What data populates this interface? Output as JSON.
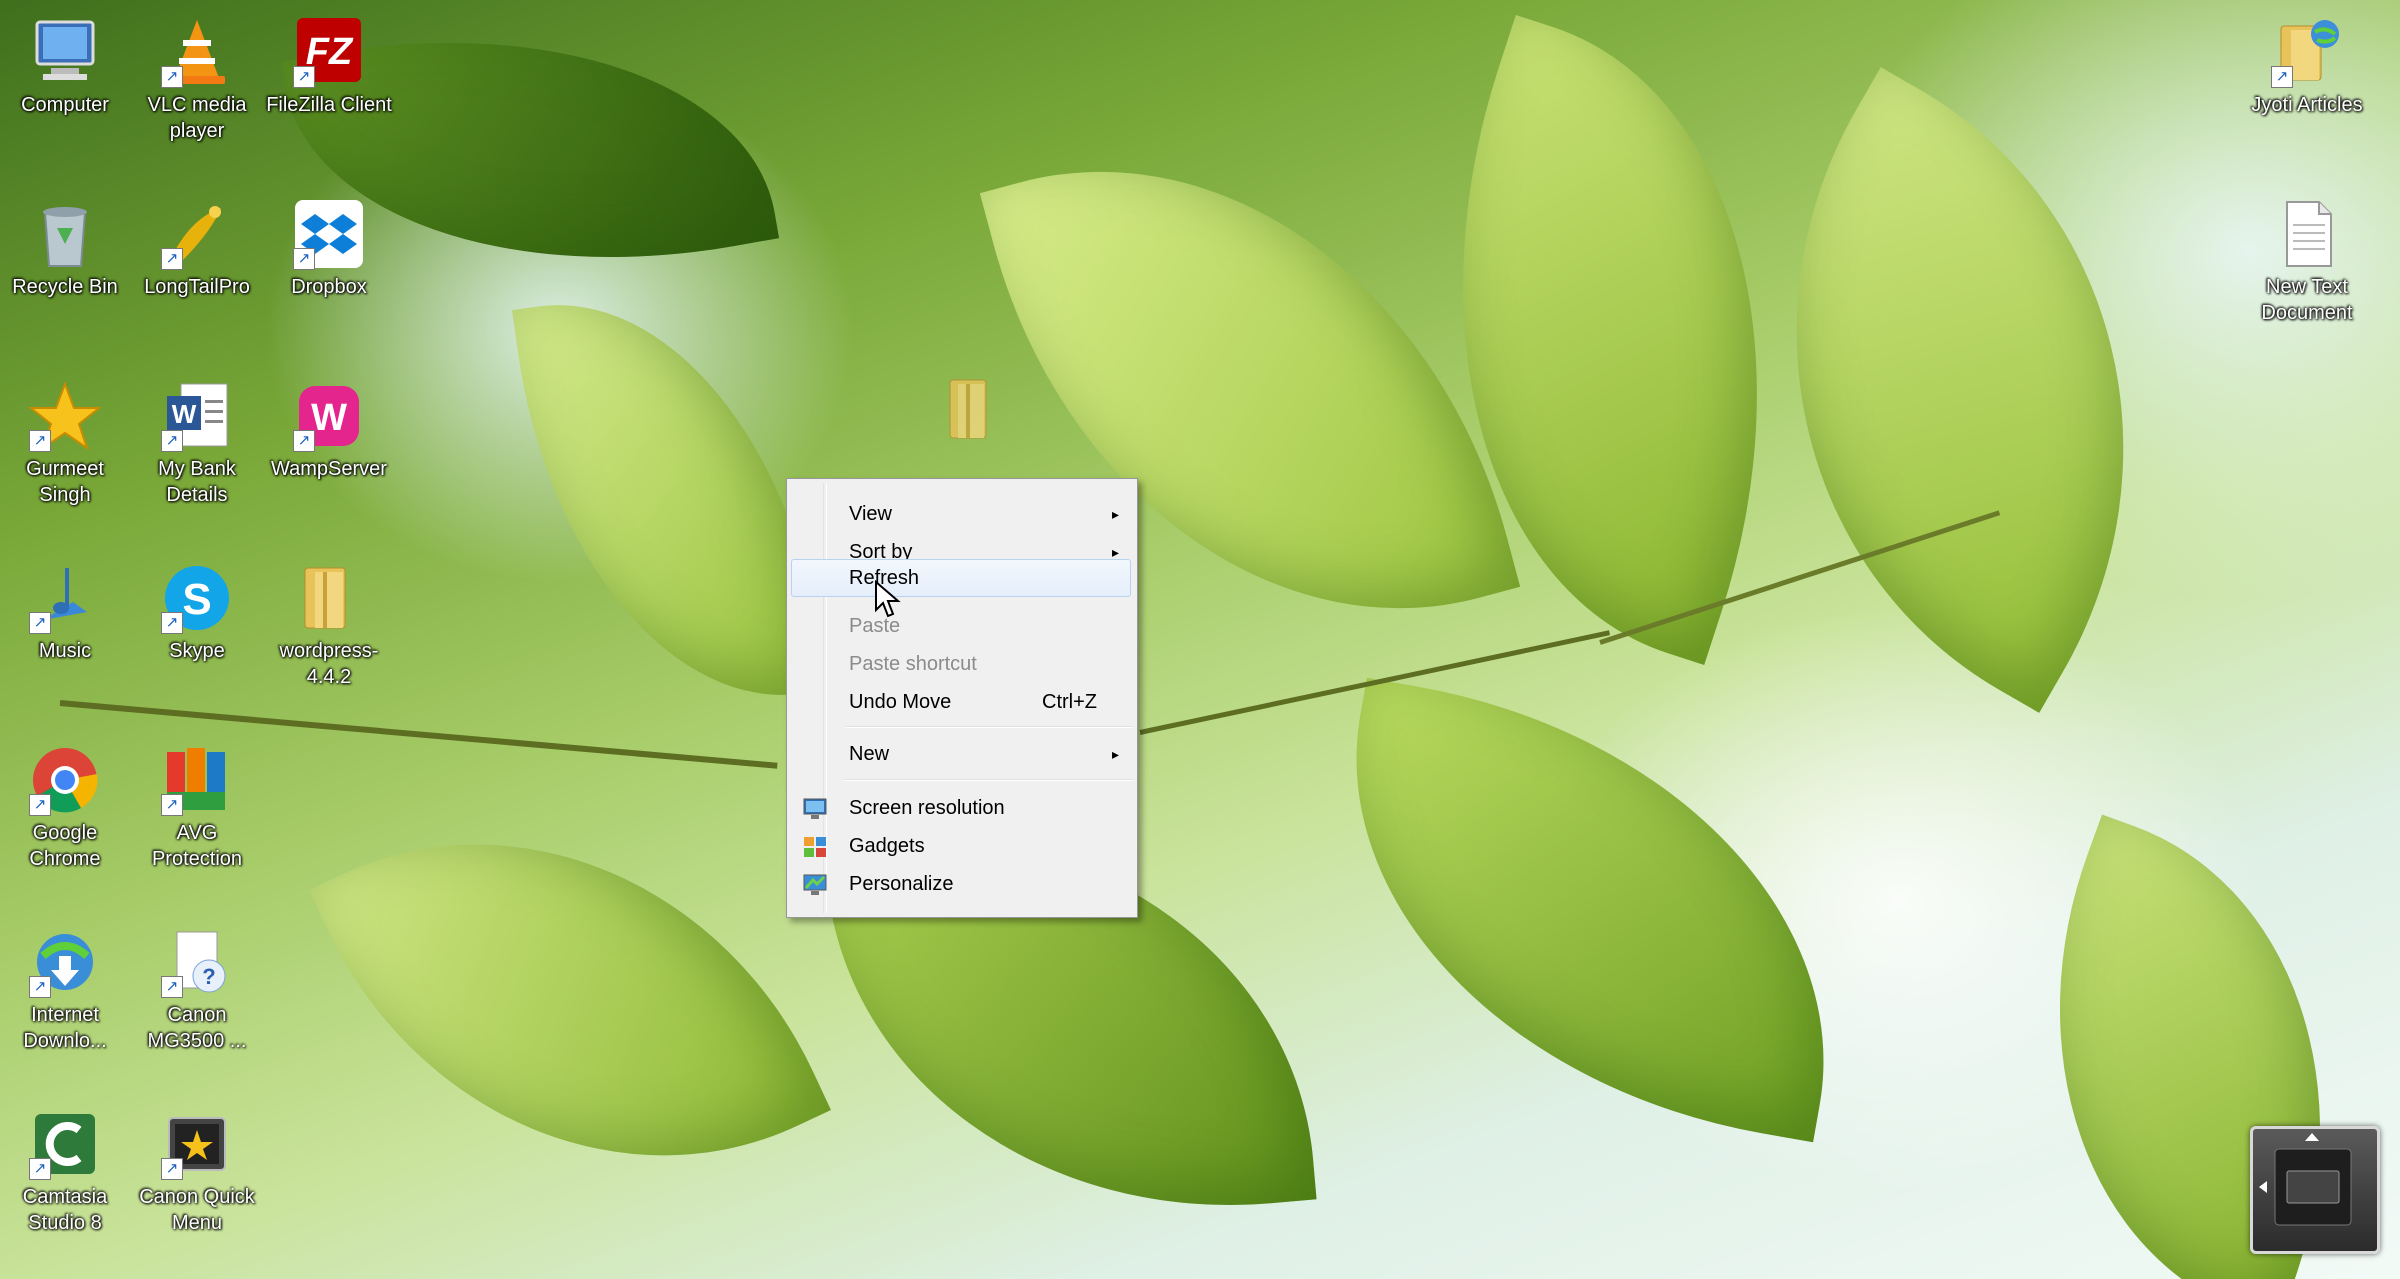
{
  "desktop": {
    "icons_left": [
      {
        "label": "Computer",
        "icon": "computer-icon"
      },
      {
        "label": "VLC media player",
        "icon": "vlc-icon"
      },
      {
        "label": "FileZilla Client",
        "icon": "filezilla-icon"
      },
      {
        "label": "Recycle Bin",
        "icon": "recycle-bin-icon"
      },
      {
        "label": "LongTailPro",
        "icon": "longtailpro-icon"
      },
      {
        "label": "Dropbox",
        "icon": "dropbox-icon"
      },
      {
        "label": "Gurmeet Singh",
        "icon": "star-icon"
      },
      {
        "label": "My Bank Details",
        "icon": "word-document-icon"
      },
      {
        "label": "WampServer",
        "icon": "wampserver-icon"
      },
      {
        "label": "Music",
        "icon": "music-icon"
      },
      {
        "label": "Skype",
        "icon": "skype-icon"
      },
      {
        "label": "wordpress-4.4.2",
        "icon": "folder-icon"
      },
      {
        "label": "Google Chrome",
        "icon": "chrome-icon"
      },
      {
        "label": "AVG Protection",
        "icon": "avg-icon"
      },
      {
        "label": "Internet Downlo...",
        "icon": "internet-download-manager-icon"
      },
      {
        "label": "Canon MG3500 ...",
        "icon": "canon-help-icon"
      },
      {
        "label": "Camtasia Studio 8",
        "icon": "camtasia-icon"
      },
      {
        "label": "Canon Quick Menu",
        "icon": "canon-quick-menu-icon"
      }
    ],
    "icons_right": [
      {
        "label": "Jyoti Articles",
        "icon": "folder-globe-icon"
      },
      {
        "label": "New Text Document",
        "icon": "text-document-icon"
      }
    ]
  },
  "context_menu": {
    "items": [
      {
        "label": "View",
        "submenu": true
      },
      {
        "label": "Sort by",
        "submenu": true
      },
      {
        "label": "Refresh",
        "highlighted": true
      },
      {
        "label": "Paste",
        "disabled": true
      },
      {
        "label": "Paste shortcut",
        "disabled": true
      },
      {
        "label": "Undo Move",
        "shortcut": "Ctrl+Z"
      },
      {
        "label": "New",
        "submenu": true
      },
      {
        "label": "Screen resolution",
        "icon": "screen-resolution-icon"
      },
      {
        "label": "Gadgets",
        "icon": "gadgets-icon"
      },
      {
        "label": "Personalize",
        "icon": "personalize-icon"
      }
    ],
    "submenu_arrow": "▸"
  },
  "colors": {
    "menu_bg": "#f0f0f0",
    "menu_highlight_border": "#b8d2f2",
    "disabled_text": "#8b8b8b"
  }
}
